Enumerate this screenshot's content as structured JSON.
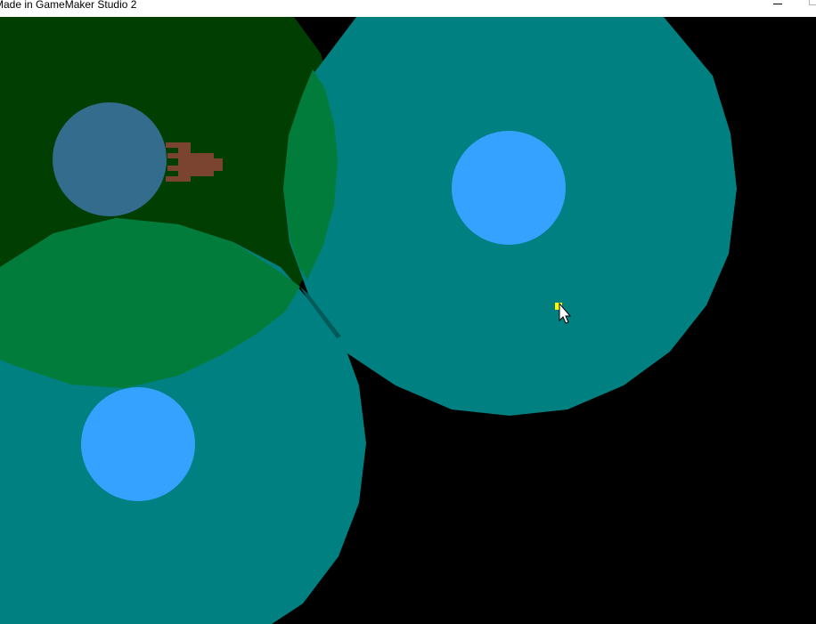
{
  "window": {
    "title": "Made in GameMaker Studio 2"
  },
  "colors": {
    "background": "#000000",
    "titlebar": "#ffffff",
    "dark_green_zone": "#013e01",
    "teal_zone": "#008080",
    "green_overlap": "#027c3a",
    "deep_overlap": "#015a3a",
    "light_blue_core": "#36a2ff",
    "muted_blue_core": "#336c8c",
    "player_sprite": "#7a4430",
    "target_marker": "#ffff00",
    "cursor": "#ffffff"
  },
  "scene": {
    "zones": [
      "dark-green-zone",
      "teal-zone-right",
      "teal-zone-bottom"
    ],
    "cores": [
      "blue-core-right",
      "blue-core-bottom",
      "muted-blue-core"
    ],
    "player": "brown-player-sprite",
    "marker": "yellow-target-marker",
    "pointer": "mouse-cursor-icon"
  }
}
